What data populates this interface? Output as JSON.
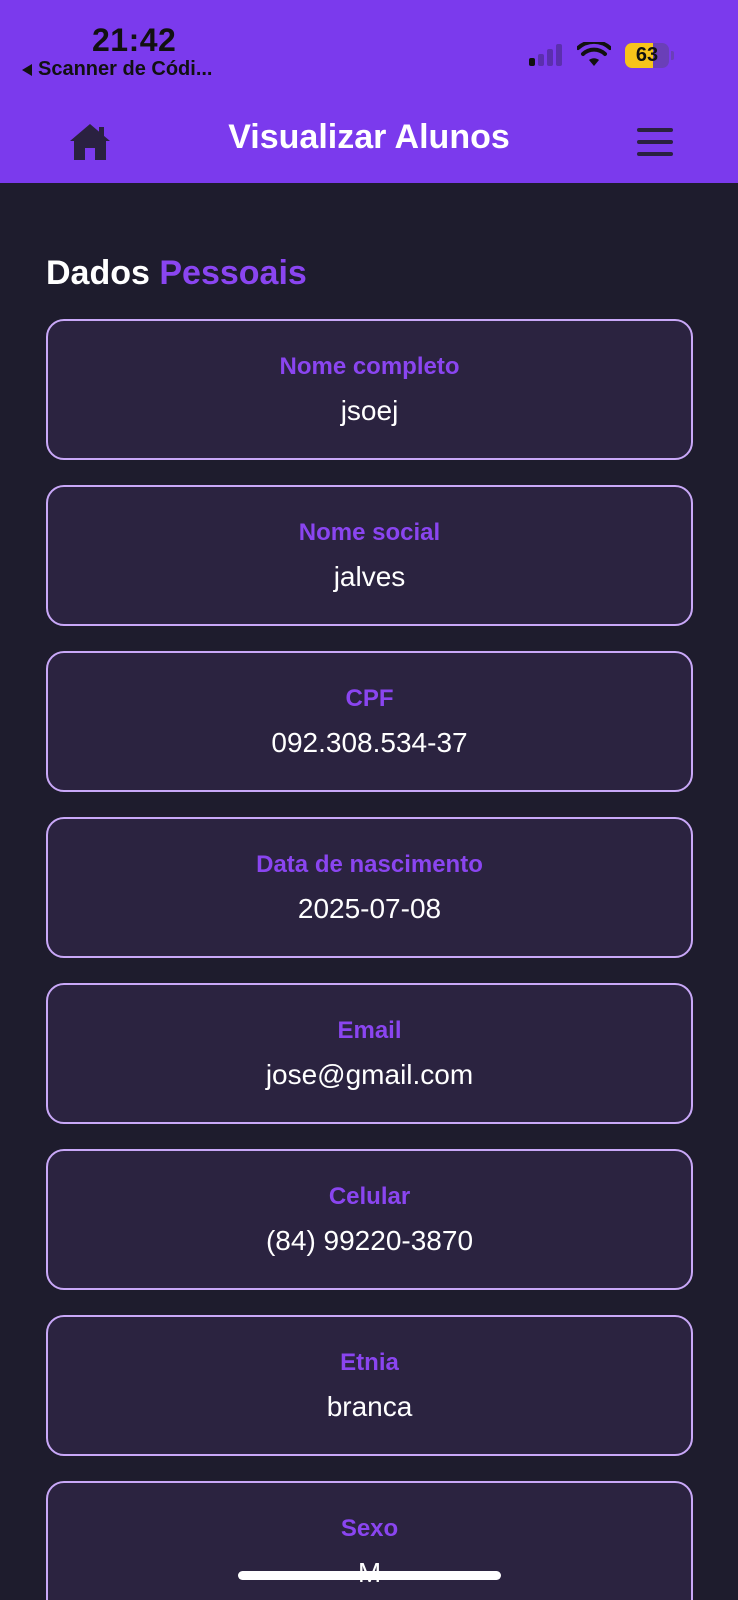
{
  "status_bar": {
    "time": "21:42",
    "back_app": "Scanner de Códi...",
    "battery": "63",
    "battery_level": 0.63
  },
  "header": {
    "title": "Visualizar Alunos",
    "home_icon": "home-icon",
    "menu_icon": "hamburger-menu-icon"
  },
  "section": {
    "title_part1": "Dados",
    "title_part2": "Pessoais"
  },
  "fields": [
    {
      "label": "Nome completo",
      "value": "jsoej"
    },
    {
      "label": "Nome social",
      "value": "jalves"
    },
    {
      "label": "CPF",
      "value": "092.308.534-37"
    },
    {
      "label": "Data de nascimento",
      "value": "2025-07-08"
    },
    {
      "label": "Email",
      "value": "jose@gmail.com"
    },
    {
      "label": "Celular",
      "value": "(84) 99220-3870"
    },
    {
      "label": "Etnia",
      "value": "branca"
    },
    {
      "label": "Sexo",
      "value": "M"
    }
  ],
  "colors": {
    "header_bg": "#7b3aed",
    "page_bg": "#1e1c2d",
    "accent": "#8a45f0",
    "card_border": "#c9a8f8",
    "battery": "#f7c41a"
  }
}
